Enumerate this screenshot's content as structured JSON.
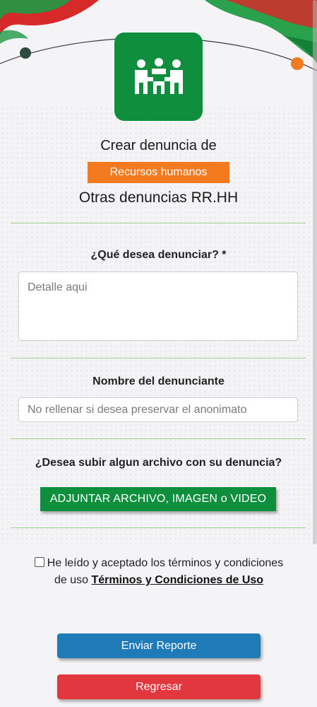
{
  "header": {
    "title_prefix": "Crear denuncia de",
    "category_badge": "Recursos humanos",
    "subtitle": "Otras denuncias RR.HH"
  },
  "form": {
    "question_label": "¿Qué desea denunciar? *",
    "detail_placeholder": "Detalle aqui",
    "name_label": "Nombre del denunciante",
    "name_placeholder": "No rellenar si desea preservar el anonimato",
    "upload_question": "¿Desea subir algun archivo con su denuncia?",
    "upload_button": "ADJUNTAR ARCHIVO, IMAGEN o VIDEO",
    "terms_text": "He leído y aceptado los términos y condiciones de uso ",
    "terms_link": "Términos y Condiciones de Uso",
    "terms_checked": false
  },
  "actions": {
    "send": "Enviar Reporte",
    "back": "Regresar"
  },
  "colors": {
    "brand_green": "#0f8f3e",
    "badge_orange": "#f47a20",
    "send_blue": "#1f7bb8",
    "back_red": "#e2373f"
  },
  "icons": {
    "logo": "people-group-icon"
  }
}
